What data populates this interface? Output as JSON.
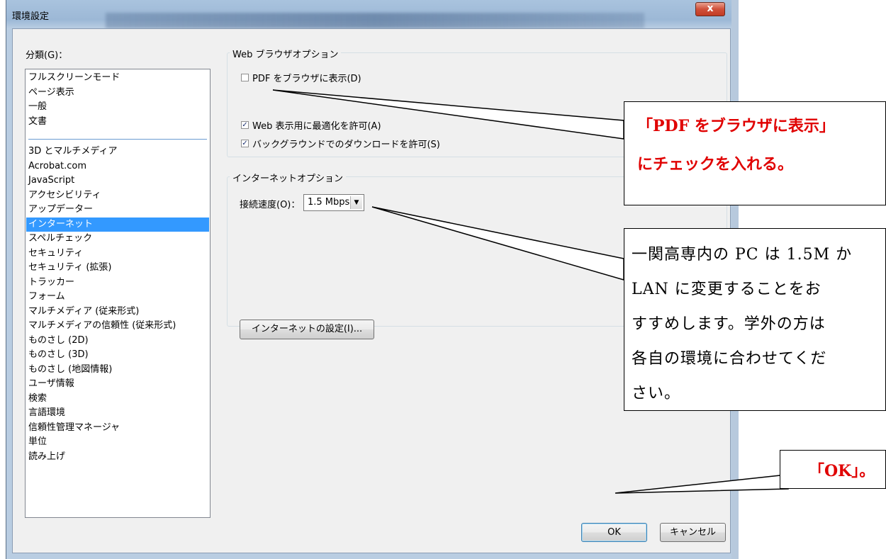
{
  "window": {
    "title": "環境設定",
    "close_glyph": "x"
  },
  "sidebar": {
    "label": "分類(G)：",
    "items": [
      "フルスクリーンモード",
      "ページ表示",
      "一般",
      "文書",
      "3D とマルチメディア",
      "Acrobat.com",
      "JavaScript",
      "アクセシビリティ",
      "アップデーター",
      "インターネット",
      "スペルチェック",
      "セキュリティ",
      "セキュリティ (拡張)",
      "トラッカー",
      "フォーム",
      "マルチメディア (従来形式)",
      "マルチメディアの信頼性 (従来形式)",
      "ものさし (2D)",
      "ものさし (3D)",
      "ものさし (地図情報)",
      "ユーザ情報",
      "検索",
      "言語環境",
      "信頼性管理マネージャ",
      "単位",
      "読み上げ"
    ],
    "selected": "インターネット"
  },
  "web_browser_options": {
    "title": "Web ブラウザオプション",
    "display_pdf_in_browser": {
      "label": "PDF をブラウザに表示(D)",
      "checked": false
    },
    "allow_fast_web_view": {
      "label": "Web 表示用に最適化を許可(A)",
      "checked": true
    },
    "allow_background_download": {
      "label": "バックグラウンドでのダウンロードを許可(S)",
      "checked": true
    }
  },
  "internet_options": {
    "title": "インターネットオプション",
    "speed_label": "接続速度(O)：",
    "speed_value": "1.5 Mbps",
    "settings_button": "インターネットの設定(I)..."
  },
  "footer": {
    "ok_label": "OK",
    "cancel_label": "キャンセル"
  },
  "annotations": {
    "callout1": [
      "「PDF をブラウザに表示」",
      "にチェックを入れる。"
    ],
    "callout2": [
      "一関高専内の PC は 1.5M か",
      "LAN に変更することをお",
      "すすめします。学外の方は",
      "各自の環境に合わせてくだ",
      "さい。"
    ],
    "callout3": "「OK」。",
    "text_color": "#e00000"
  },
  "colors": {
    "selection": "#3399ff",
    "dialog_bg": "#f0f0f0",
    "close_button": "#c23b23"
  }
}
